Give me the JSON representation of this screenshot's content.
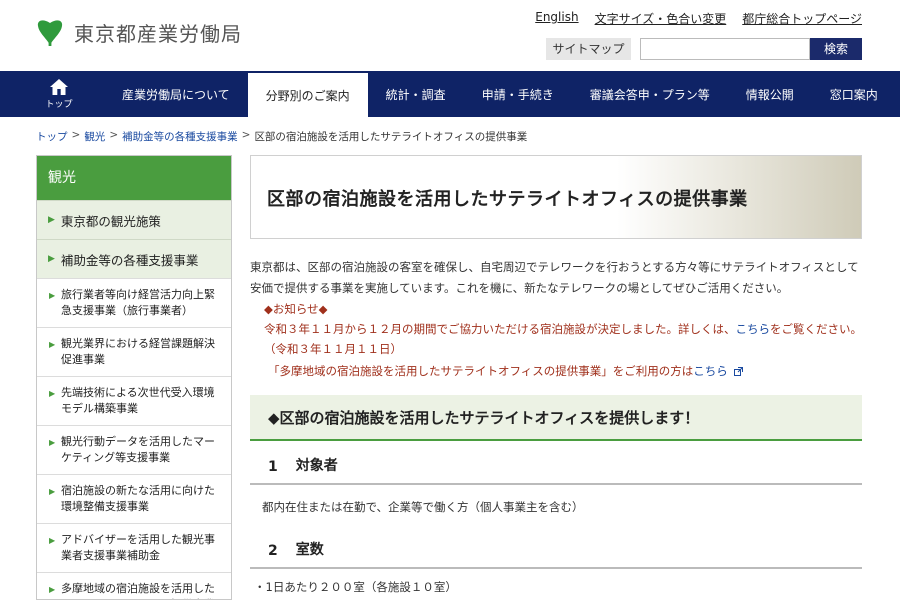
{
  "header": {
    "site_name": "東京都産業労働局",
    "util_links": [
      "English",
      "文字サイズ・色合い変更",
      "都庁総合トップページ"
    ],
    "sitemap_label": "サイトマップ",
    "search_placeholder": "",
    "search_label": "検索"
  },
  "nav": {
    "home_label": "トップ",
    "items": [
      "産業労働局について",
      "分野別のご案内",
      "統計・調査",
      "申請・手続き",
      "審議会答申・プラン等",
      "情報公開",
      "窓口案内"
    ],
    "active_index": 1
  },
  "breadcrumb": [
    "トップ",
    "観光",
    "補助金等の各種支援事業",
    "区部の宿泊施設を活用したサテライトオフィスの提供事業"
  ],
  "sidebar": {
    "heading": "観光",
    "level1": [
      "東京都の観光施策",
      "補助金等の各種支援事業"
    ],
    "level2": [
      "旅行業者等向け経営活力向上緊急支援事業（旅行事業者）",
      "観光業界における経営課題解決促進事業",
      "先端技術による次世代受入環境モデル構築事業",
      "観光行動データを活用したマーケティング等支援事業",
      "宿泊施設の新たな活用に向けた環境整備支援事業",
      "アドバイザーを活用した観光事業者支援事業補助金",
      "多摩地域の宿泊施設を活用したサテライトオフィスの提供事業"
    ]
  },
  "main": {
    "title": "区部の宿泊施設を活用したサテライトオフィスの提供事業",
    "intro": "東京都は、区部の宿泊施設の客室を確保し、自宅周辺でテレワークを行おうとする方々等にサテライトオフィスとして安価で提供する事業を実施しています。これを機に、新たなテレワークの場としてぜひご活用ください。",
    "notice_head": "◆お知らせ◆",
    "notice_text": "令和３年１１月から１２月の期間でご協力いただける宿泊施設が決定しました。詳しくは、",
    "notice_link": "こちら",
    "notice_tail": "をご覧ください。（令和３年１１月１１日）",
    "tama_text": "「多摩地域の宿泊施設を活用したサテライトオフィスの提供事業」をご利用の方は",
    "tama_link": "こちら",
    "section_heading": "◆区部の宿泊施設を活用したサテライトオフィスを提供します！",
    "sec1_num": "1",
    "sec1_title": "対象者",
    "sec1_text": "都内在住または在勤で、企業等で働く方（個人事業主を含む）",
    "sec2_num": "2",
    "sec2_title": "室数",
    "sec2_text": "・1日あたり２００室（各施設１０室）"
  },
  "colors": {
    "nav_bg": "#0f2366",
    "sidebar_head": "#4a9d3f",
    "notice": "#a0301c",
    "link": "#1a4aa0"
  }
}
